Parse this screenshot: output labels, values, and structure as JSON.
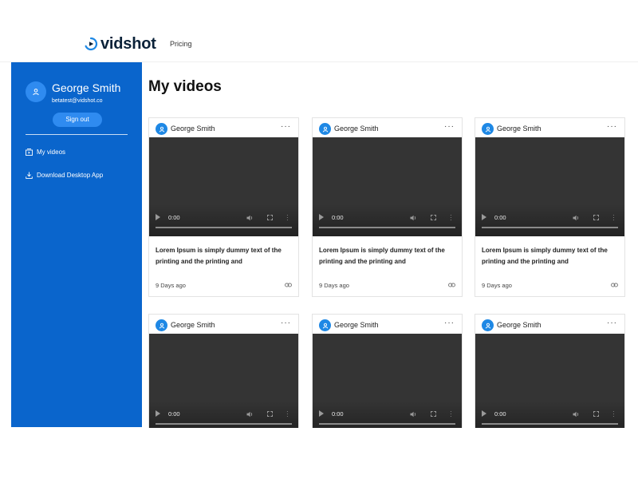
{
  "header": {
    "logo_text": "vidshot",
    "nav": [
      {
        "label": "Pricing"
      }
    ]
  },
  "sidebar": {
    "user": {
      "name": "George Smith",
      "email": "betatest@vidshot.co"
    },
    "signout_label": "Sign out",
    "items": [
      {
        "label": "My videos",
        "icon": "video-library-icon"
      },
      {
        "label": "Download Desktop App",
        "icon": "download-icon"
      }
    ]
  },
  "main": {
    "title": "My videos",
    "videos": [
      {
        "author": "George Smith",
        "time": "0:00",
        "description": "Lorem Ipsum is simply dummy text of the printing and the printing and",
        "age": "9 Days ago"
      },
      {
        "author": "George Smith",
        "time": "0:00",
        "description": "Lorem Ipsum is simply dummy text of the printing and the printing and",
        "age": "9 Days ago"
      },
      {
        "author": "George Smith",
        "time": "0:00",
        "description": "Lorem Ipsum is simply dummy text of the printing and the printing and",
        "age": "9 Days ago"
      },
      {
        "author": "George Smith",
        "time": "0:00"
      },
      {
        "author": "George Smith",
        "time": "0:00"
      },
      {
        "author": "George Smith",
        "time": "0:00"
      }
    ],
    "more_glyph": "···"
  },
  "colors": {
    "brand": "#0a65cc",
    "accent": "#2f8bf0",
    "video_bg": "#343434"
  }
}
